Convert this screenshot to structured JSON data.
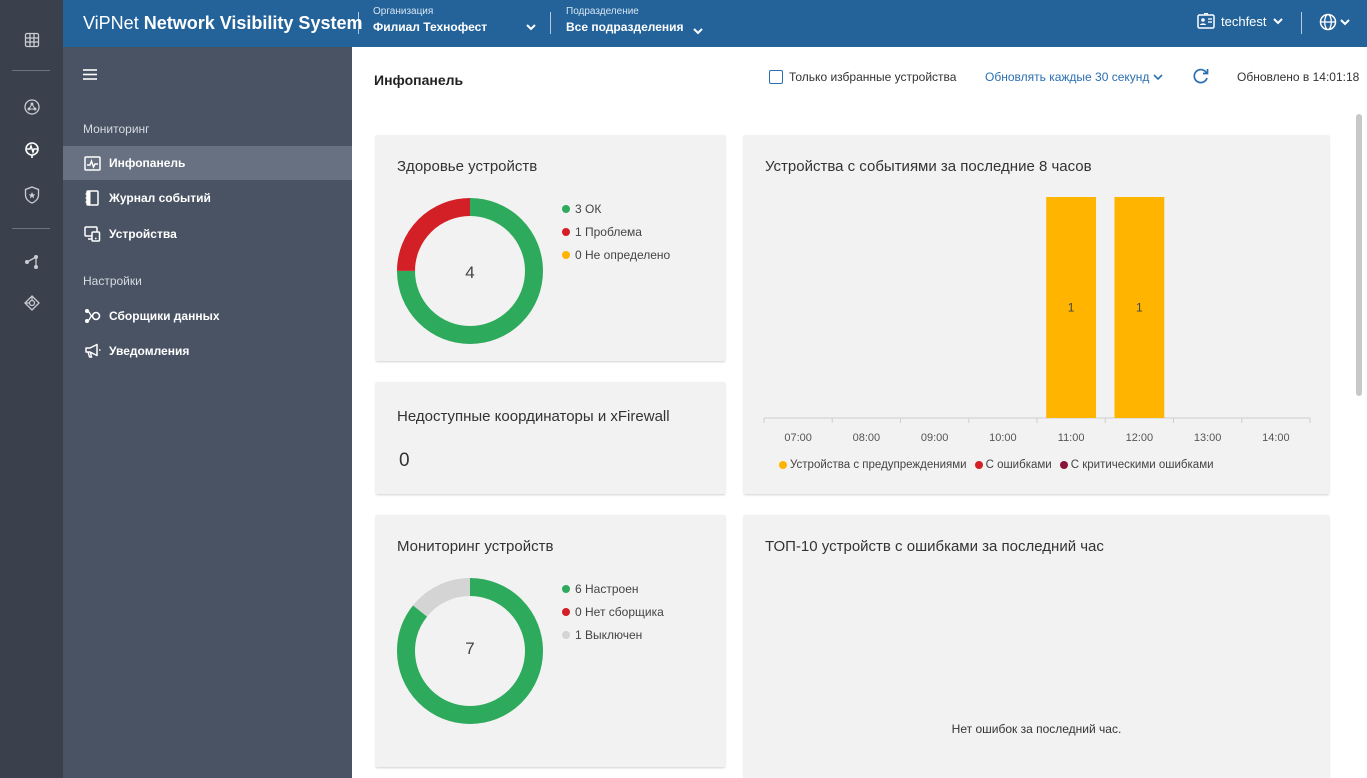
{
  "app": {
    "brand_light": "ViPNet",
    "brand_bold": "Network Visibility System"
  },
  "header": {
    "org_caption": "Организация",
    "org_value": "Филиал Технофест",
    "div_caption": "Подразделение",
    "div_value": "Все подразделения",
    "user": "techfest"
  },
  "sidebar": {
    "monitoring_title": "Мониторинг",
    "settings_title": "Настройки",
    "items": [
      {
        "label": "Инфопанель",
        "icon": "dashboard-icon"
      },
      {
        "label": "Журнал событий",
        "icon": "journal-icon"
      },
      {
        "label": "Устройства",
        "icon": "devices-icon"
      },
      {
        "label": "Сборщики данных",
        "icon": "collectors-icon"
      },
      {
        "label": "Уведомления",
        "icon": "megaphone-icon"
      }
    ]
  },
  "main": {
    "title": "Инфопанель",
    "favorites_label": "Только избранные устройства",
    "refresh_label": "Обновлять каждые 30 секунд",
    "updated_label": "Обновлено в 14:01:18"
  },
  "health": {
    "title": "Здоровье устройств",
    "total": "4",
    "legend": [
      "3 ОК",
      "1 Проблема",
      "0 Не определено"
    ],
    "values": [
      3,
      1,
      0
    ],
    "colors": [
      "#2eaa5c",
      "#d32027",
      "#ffb400"
    ]
  },
  "unavailable": {
    "title": "Недоступные координаторы и xFirewall",
    "value": "0"
  },
  "monitoring": {
    "title": "Мониторинг устройств",
    "total": "7",
    "legend": [
      "6 Настроен",
      "0 Нет сборщика",
      "1 Выключен"
    ],
    "values": [
      6,
      0,
      1
    ],
    "colors": [
      "#2eaa5c",
      "#d32027",
      "#d4d4d4"
    ]
  },
  "events": {
    "title": "Устройства с событиями за последние 8 часов",
    "legend": [
      "Устройства с предупреждениями",
      "С ошибками",
      "С критическими ошибками"
    ],
    "legend_colors": [
      "#ffb400",
      "#d32027",
      "#8b1538"
    ]
  },
  "top10": {
    "title": "ТОП-10 устройств с ошибками за последний час",
    "empty": "Нет ошибок за последний час."
  },
  "chart_data": {
    "type": "bar",
    "categories": [
      "07:00",
      "08:00",
      "09:00",
      "10:00",
      "11:00",
      "12:00",
      "13:00",
      "14:00"
    ],
    "series": [
      {
        "name": "Устройства с предупреждениями",
        "values": [
          0,
          0,
          0,
          0,
          1,
          1,
          0,
          0
        ],
        "color": "#ffb400"
      },
      {
        "name": "С ошибками",
        "values": [
          0,
          0,
          0,
          0,
          0,
          0,
          0,
          0
        ],
        "color": "#d32027"
      },
      {
        "name": "С критическими ошибками",
        "values": [
          0,
          0,
          0,
          0,
          0,
          0,
          0,
          0
        ],
        "color": "#8b1538"
      }
    ],
    "title": "Устройства с событиями за последние 8 часов",
    "legend_position": "bottom"
  }
}
